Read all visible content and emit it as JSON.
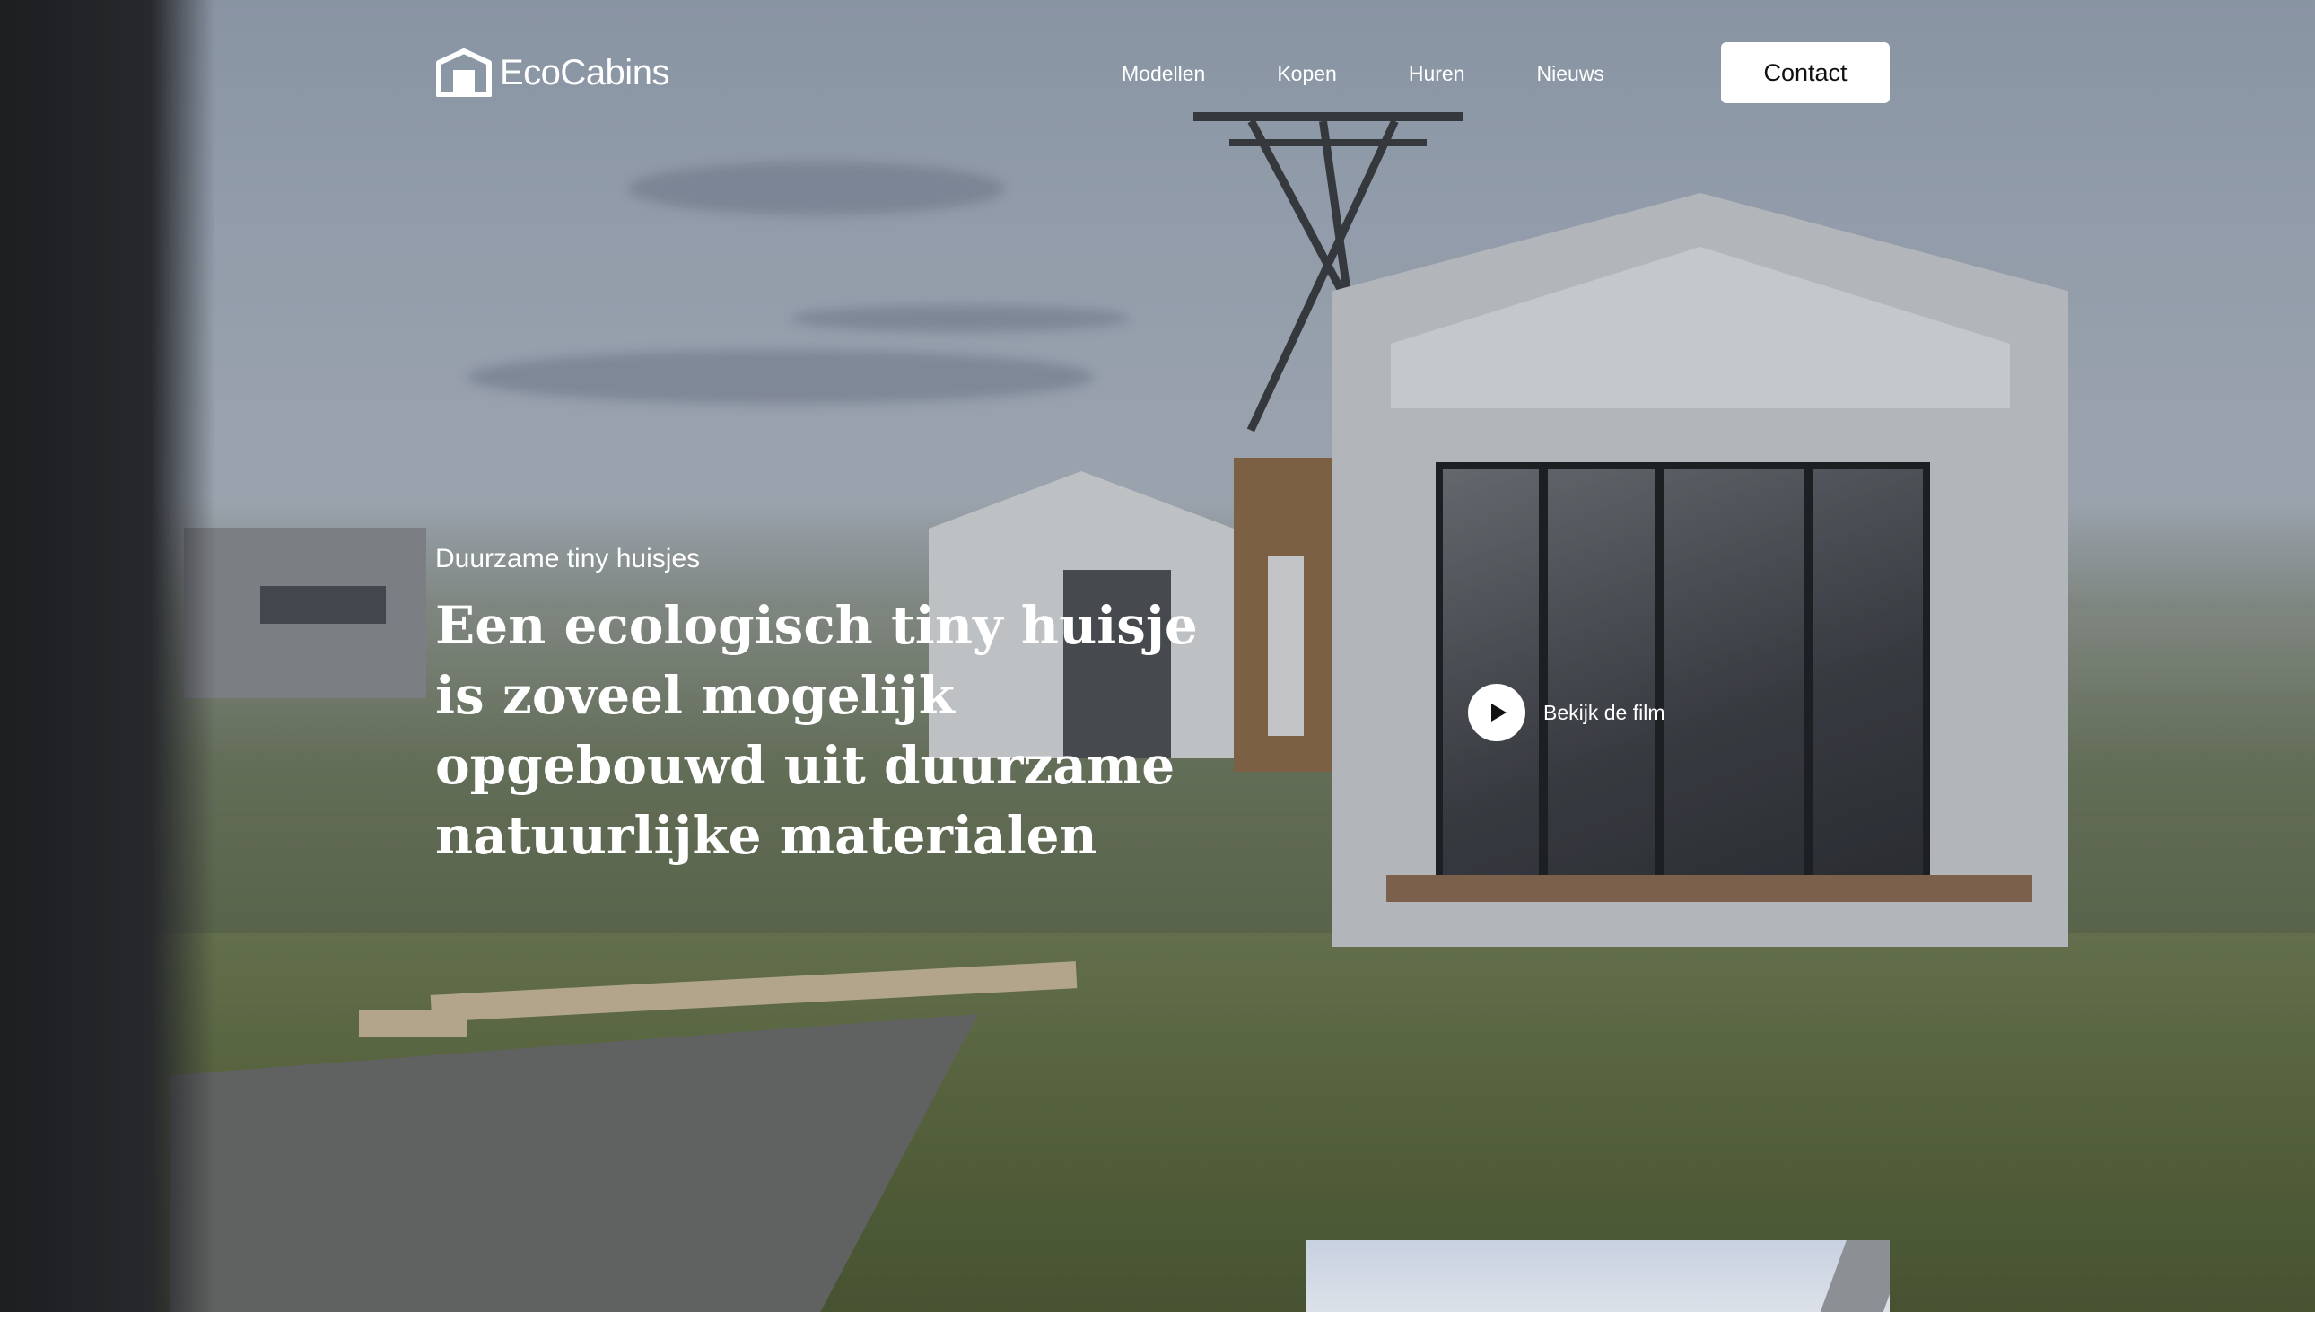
{
  "brand": {
    "name": "EcoCabins"
  },
  "nav": {
    "items": [
      "Modellen",
      "Kopen",
      "Huren",
      "Nieuws"
    ],
    "contact_label": "Contact"
  },
  "hero": {
    "eyebrow": "Duurzame tiny huisjes",
    "headline": "Een ecologisch tiny huisje is zoveel mogelijk opgebouwd uit duurzame natuurlijke materialen",
    "film_label": "Bekijk de film"
  },
  "icons": {
    "logo": "cabin-logo-icon",
    "play": "play-icon"
  },
  "colors": {
    "text": "#ffffff",
    "button_bg": "#ffffff",
    "button_text": "#111111"
  }
}
